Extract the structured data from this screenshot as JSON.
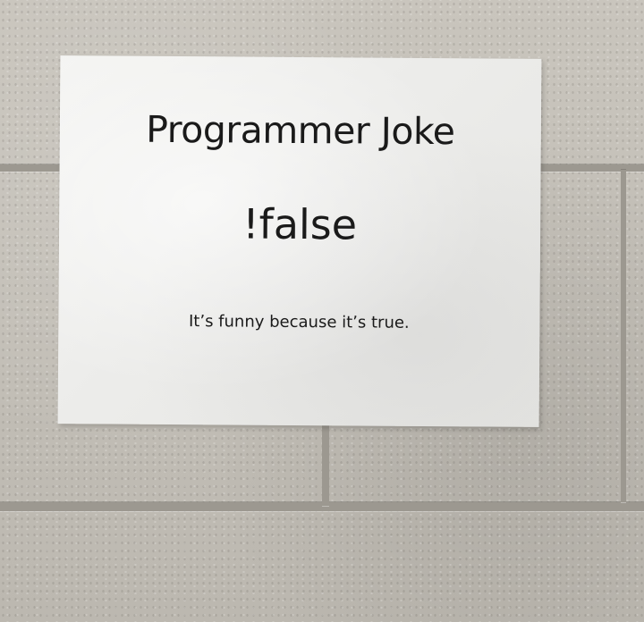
{
  "sign": {
    "title": "Programmer Joke",
    "joke": "!false",
    "punchline": "It’s funny because it’s true."
  },
  "colors": {
    "wall": "#c4c0b8",
    "mortar": "#9c9890",
    "paper": "#eeeeec",
    "ink": "#1a1a1a"
  }
}
